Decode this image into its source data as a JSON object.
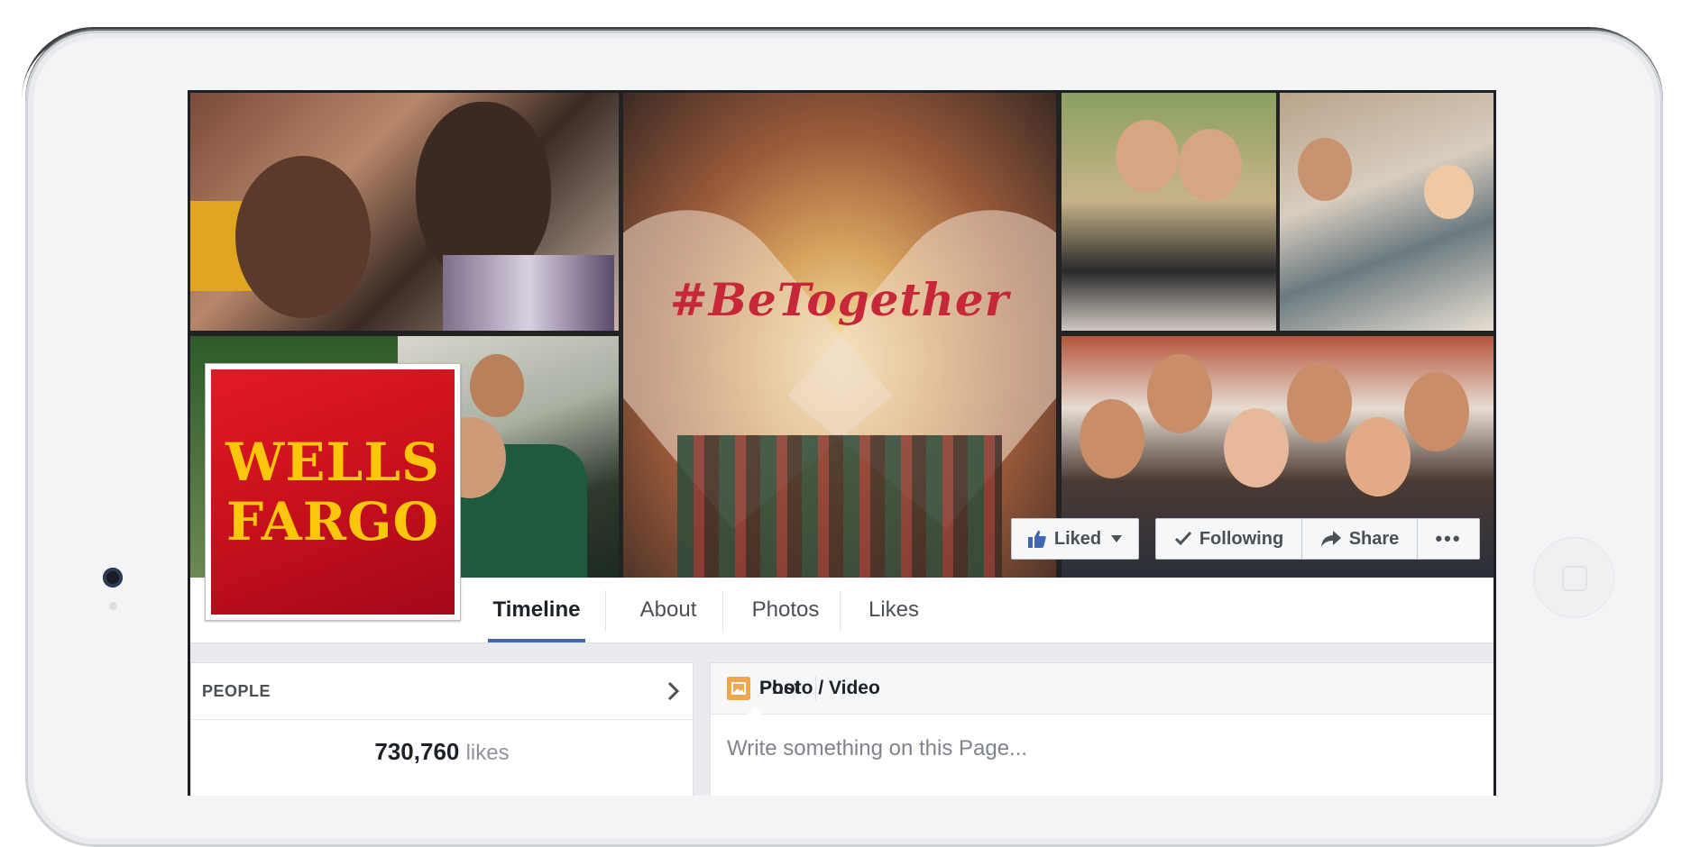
{
  "cover": {
    "hashtag": "#BeTogether"
  },
  "profile": {
    "logo_line1": "WELLS",
    "logo_line2": "FARGO"
  },
  "actions": {
    "liked_label": "Liked",
    "following_label": "Following",
    "share_label": "Share",
    "more_label": "•••"
  },
  "tabs": [
    {
      "label": "Timeline",
      "active": true
    },
    {
      "label": "About",
      "active": false
    },
    {
      "label": "Photos",
      "active": false
    },
    {
      "label": "Likes",
      "active": false
    }
  ],
  "people": {
    "title": "PEOPLE",
    "likes_count": "730,760",
    "likes_unit": "likes"
  },
  "composer": {
    "post_label": "Post",
    "photo_label": "Photo / Video",
    "placeholder": "Write something on this Page..."
  },
  "colors": {
    "brand_red": "#d71e28",
    "brand_gold": "#fcc60b",
    "facebook_blue": "#4267b2",
    "hashtag_red": "#c6283a"
  },
  "icons": [
    "thumbs-up-icon",
    "caret-down-icon",
    "checkmark-icon",
    "share-arrow-icon",
    "more-dots-icon",
    "chevron-right-icon",
    "pencil-icon",
    "photo-icon"
  ]
}
